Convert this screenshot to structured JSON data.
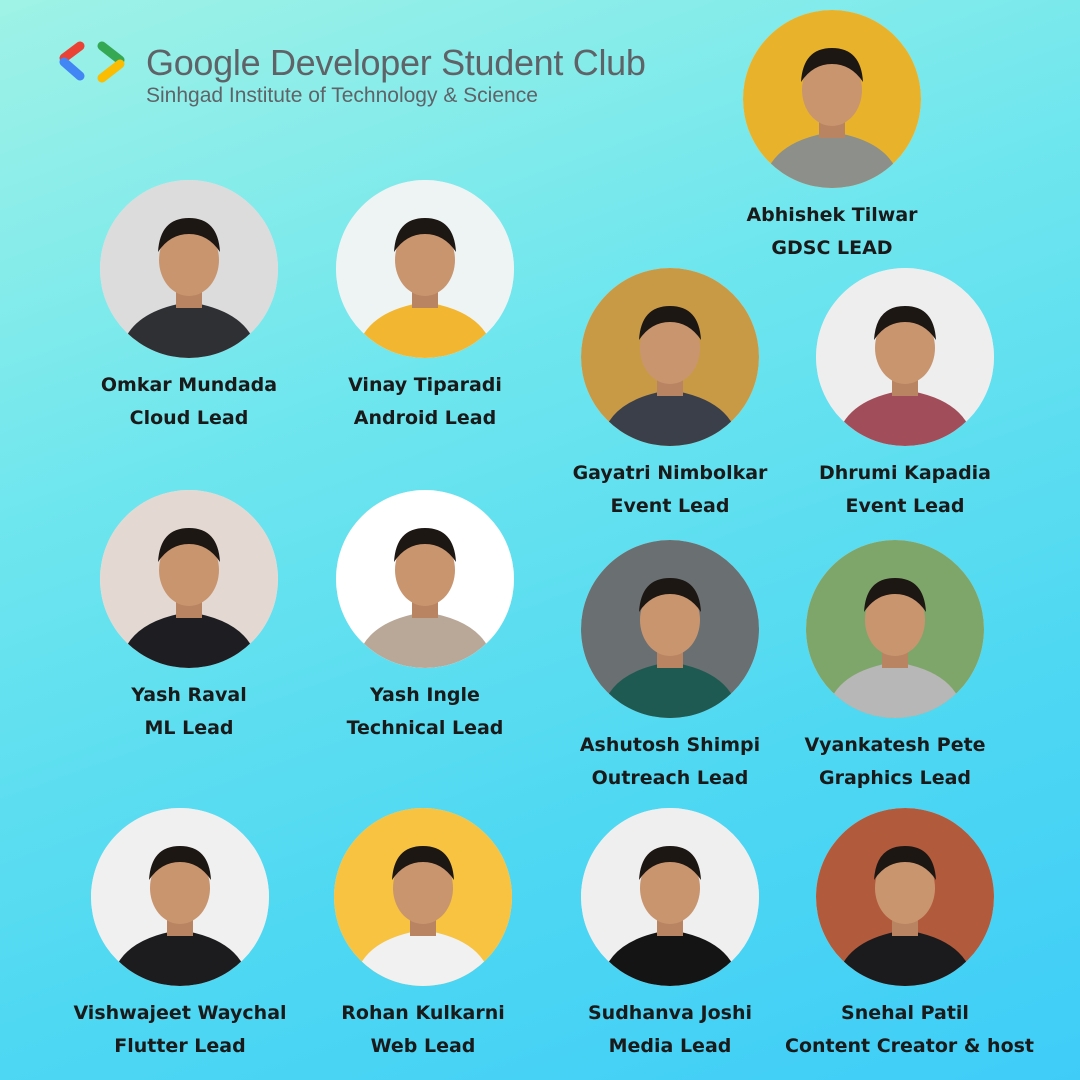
{
  "header": {
    "title": "Google Developer Student Club",
    "subtitle": "Sinhgad Institute of Technology & Science",
    "logo_icon": "gdsc-brackets-icon",
    "colors": {
      "red": "#ea4335",
      "blue": "#4285f4",
      "green": "#34a853",
      "yellow": "#fbbc04"
    }
  },
  "members": [
    {
      "name": "Abhishek Tilwar",
      "role": "GDSC LEAD",
      "photo_bg": "#e8b32a",
      "shirt": "#8c8f8a"
    },
    {
      "name": "Omkar Mundada",
      "role": "Cloud Lead",
      "photo_bg": "#dcdcdc",
      "shirt": "#2f3033"
    },
    {
      "name": "Vinay Tiparadi",
      "role": "Android Lead",
      "photo_bg": "#eef4f4",
      "shirt": "#f2b630"
    },
    {
      "name": "Gayatri Nimbolkar",
      "role": "Event Lead",
      "photo_bg": "#c99a45",
      "shirt": "#3b3f4a"
    },
    {
      "name": "Dhrumi Kapadia",
      "role": "Event Lead",
      "photo_bg": "#eeeeee",
      "shirt": "#a14e5a"
    },
    {
      "name": "Yash Raval",
      "role": "ML Lead",
      "photo_bg": "#e4d9d2",
      "shirt": "#1e1e22"
    },
    {
      "name": "Yash Ingle",
      "role": "Technical Lead",
      "photo_bg": "#ffffff",
      "shirt": "#b9a797"
    },
    {
      "name": "Ashutosh Shimpi",
      "role": "Outreach Lead",
      "photo_bg": "#6a6f72",
      "shirt": "#1f5a52"
    },
    {
      "name": "Vyankatesh Pete",
      "role": "Graphics Lead",
      "photo_bg": "#7fa66a",
      "shirt": "#b7b7b7"
    },
    {
      "name": "Vishwajeet Waychal",
      "role": "Flutter Lead",
      "photo_bg": "#f0f0f0",
      "shirt": "#1c1c1f"
    },
    {
      "name": "Rohan Kulkarni",
      "role": "Web Lead",
      "photo_bg": "#f7c340",
      "shirt": "#f1f1f1"
    },
    {
      "name": "Sudhanva Joshi",
      "role": "Media Lead",
      "photo_bg": "#efefef",
      "shirt": "#141414"
    },
    {
      "name": "Snehal Patil",
      "role": "Content Creator & host",
      "photo_bg": "#b25a3c",
      "shirt": "#1b1b1d"
    }
  ]
}
